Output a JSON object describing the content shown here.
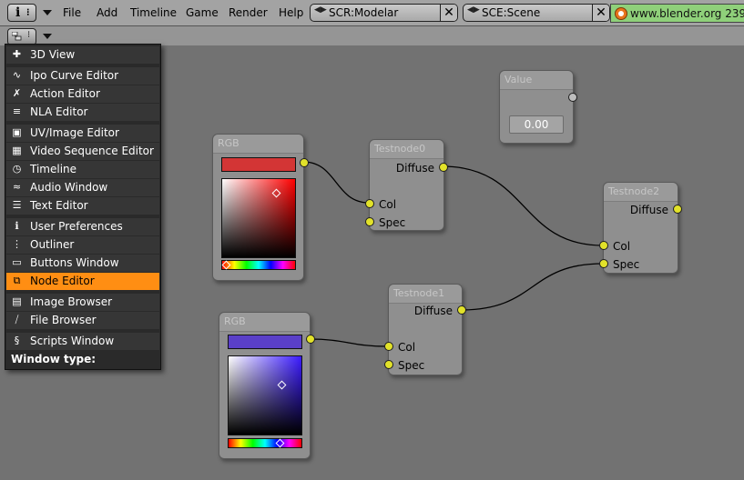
{
  "topbar": {
    "info_glyph": "i",
    "menus": [
      "File",
      "Add",
      "Timeline",
      "Game",
      "Render",
      "Help"
    ],
    "screen_field": "SCR:Modelar",
    "scene_field": "SCE:Scene",
    "close_glyph": "✕",
    "url_text": "www.blender.org 239"
  },
  "editor_header": {
    "window_type_icon": "node-editor-icon"
  },
  "window_type_menu": {
    "items": [
      {
        "label": "3D View",
        "icon": "3d-view-icon"
      },
      {
        "label": "Ipo Curve Editor",
        "icon": "ipo-curve-icon"
      },
      {
        "label": "Action Editor",
        "icon": "action-editor-icon"
      },
      {
        "label": "NLA Editor",
        "icon": "nla-editor-icon"
      },
      {
        "label": "UV/Image Editor",
        "icon": "uv-image-icon"
      },
      {
        "label": "Video Sequence Editor",
        "icon": "video-sequence-icon"
      },
      {
        "label": "Timeline",
        "icon": "timeline-icon"
      },
      {
        "label": "Audio Window",
        "icon": "audio-icon"
      },
      {
        "label": "Text Editor",
        "icon": "text-editor-icon"
      },
      {
        "label": "User Preferences",
        "icon": "user-preferences-icon"
      },
      {
        "label": "Outliner",
        "icon": "outliner-icon"
      },
      {
        "label": "Buttons Window",
        "icon": "buttons-window-icon"
      },
      {
        "label": "Node Editor",
        "icon": "node-editor-icon",
        "active": true
      },
      {
        "label": "Image Browser",
        "icon": "image-browser-icon"
      },
      {
        "label": "File Browser",
        "icon": "file-browser-icon"
      },
      {
        "label": "Scripts Window",
        "icon": "scripts-window-icon"
      }
    ],
    "footer": "Window type:",
    "active_color": "#ff8e13"
  },
  "nodes": {
    "rgb1": {
      "title": "RGB",
      "color": "#d33535",
      "hue_color": "#ff0000"
    },
    "rgb2": {
      "title": "RGB",
      "color": "#5a3fc8",
      "hue_color": "#3b1bff"
    },
    "value": {
      "title": "Value",
      "value": "0.00"
    },
    "testnode0": {
      "title": "Testnode0",
      "out": "Diffuse",
      "in1": "Col",
      "in2": "Spec"
    },
    "testnode1": {
      "title": "Testnode1",
      "out": "Diffuse",
      "in1": "Col",
      "in2": "Spec"
    },
    "testnode2": {
      "title": "Testnode2",
      "out": "Diffuse",
      "in1": "Col",
      "in2": "Spec"
    }
  },
  "colors": {
    "socket": "#e2e22a",
    "link": "#000000",
    "canvas": "#727272"
  }
}
